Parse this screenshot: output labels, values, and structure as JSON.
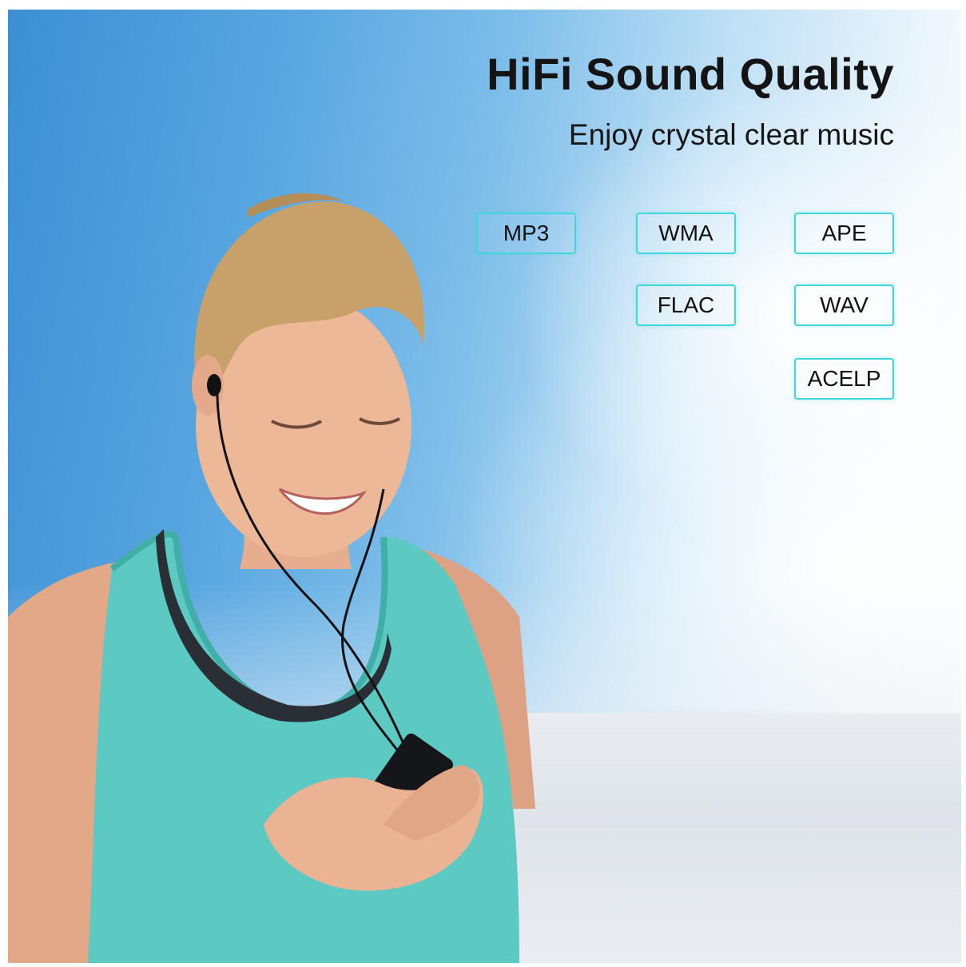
{
  "headline": {
    "title": "HiFi Sound Quality",
    "subtitle": "Enjoy crystal clear music"
  },
  "formats": [
    {
      "label": "MP3"
    },
    {
      "label": "WMA"
    },
    {
      "label": "APE"
    },
    {
      "label": "FLAC"
    },
    {
      "label": "WAV"
    },
    {
      "label": "ACELP"
    }
  ],
  "colors": {
    "badge_border": "#3fd6dc",
    "title_text": "#141414",
    "sky": "#3b8fd4",
    "tank_top": "#5cc9c3"
  },
  "photo": {
    "subject": "woman-listening-with-earphones-photo"
  }
}
